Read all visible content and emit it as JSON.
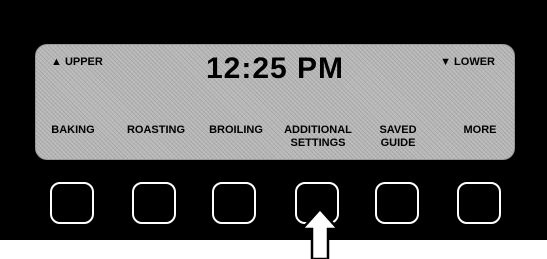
{
  "display": {
    "upper_label": "▲ UPPER",
    "lower_label": "▼ LOWER",
    "time": "12:25 PM"
  },
  "menu": [
    {
      "line1": "",
      "line2": "BAKING"
    },
    {
      "line1": "",
      "line2": "ROASTING"
    },
    {
      "line1": "",
      "line2": "BROILING"
    },
    {
      "line1": "ADDITIONAL",
      "line2": "SETTINGS"
    },
    {
      "line1": "SAVED",
      "line2": "GUIDE"
    },
    {
      "line1": "",
      "line2": "MORE"
    }
  ],
  "colors": {
    "panel": "#000000",
    "lcd": "#b9b9b9",
    "button_border": "#ffffff"
  },
  "indicator": {
    "icon": "up-arrow-icon",
    "points_to_button_index": 3
  }
}
